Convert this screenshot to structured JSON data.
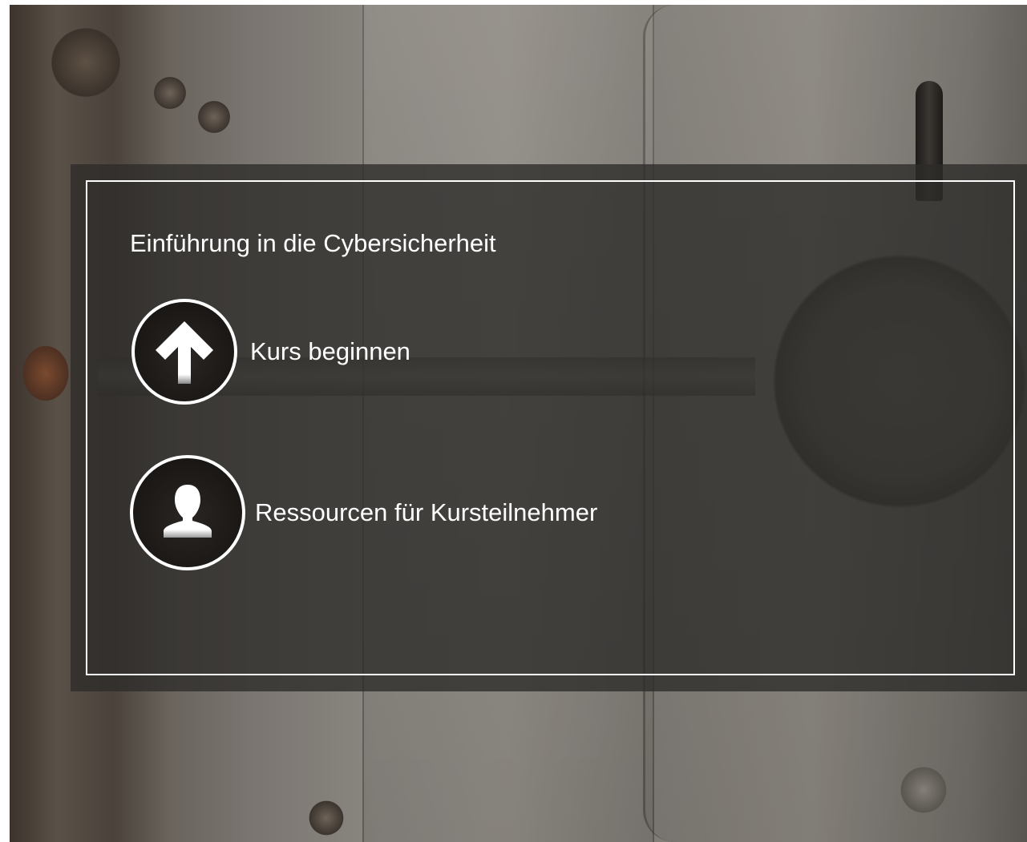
{
  "course": {
    "title": "Einführung in die Cybersicherheit"
  },
  "menu": {
    "items": [
      {
        "label": "Kurs beginnen",
        "icon": "arrow-up-icon"
      },
      {
        "label": "Ressourcen für Kursteilnehmer",
        "icon": "user-icon"
      }
    ]
  },
  "colors": {
    "overlay": "#2d2b29",
    "text": "#ffffff",
    "icon_fill": "#1a1715"
  }
}
